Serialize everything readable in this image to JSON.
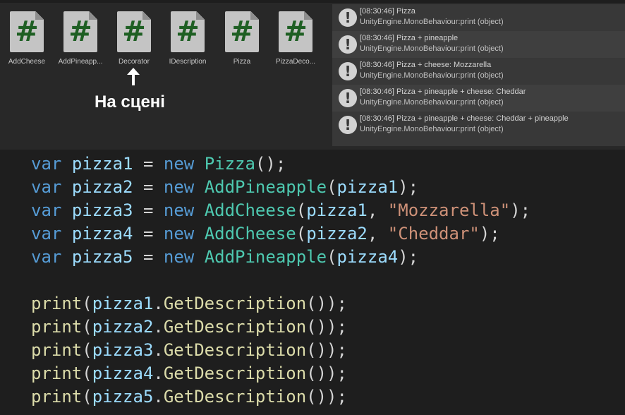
{
  "project": {
    "assets": [
      {
        "name": "AddCheese",
        "icon": "csharp-script-icon"
      },
      {
        "name": "AddPineapp...",
        "icon": "csharp-script-icon"
      },
      {
        "name": "Decorator",
        "icon": "csharp-script-icon"
      },
      {
        "name": "IDescription",
        "icon": "csharp-script-icon"
      },
      {
        "name": "Pizza",
        "icon": "csharp-script-icon"
      },
      {
        "name": "PizzaDeco...",
        "icon": "csharp-script-icon"
      }
    ],
    "icon_glyph": "#",
    "annotation": "На сцені"
  },
  "console": {
    "entries": [
      {
        "line1": "[08:30:46] Pizza",
        "line2": "UnityEngine.MonoBehaviour:print (object)"
      },
      {
        "line1": "[08:30:46] Pizza + pineapple",
        "line2": "UnityEngine.MonoBehaviour:print (object)"
      },
      {
        "line1": "[08:30:46] Pizza + cheese: Mozzarella",
        "line2": "UnityEngine.MonoBehaviour:print (object)"
      },
      {
        "line1": "[08:30:46] Pizza + pineapple + cheese: Cheddar",
        "line2": "UnityEngine.MonoBehaviour:print (object)"
      },
      {
        "line1": "[08:30:46] Pizza + pineapple + cheese: Cheddar + pineapple",
        "line2": "UnityEngine.MonoBehaviour:print (object)"
      }
    ],
    "icon": "!"
  },
  "code": {
    "lines": [
      [
        {
          "t": "var",
          "c": "kw"
        },
        {
          "t": " ",
          "c": "pn"
        },
        {
          "t": "pizza1",
          "c": "var"
        },
        {
          "t": " = ",
          "c": "pn"
        },
        {
          "t": "new",
          "c": "kw"
        },
        {
          "t": " ",
          "c": "pn"
        },
        {
          "t": "Pizza",
          "c": "type"
        },
        {
          "t": "();",
          "c": "pn"
        }
      ],
      [
        {
          "t": "var",
          "c": "kw"
        },
        {
          "t": " ",
          "c": "pn"
        },
        {
          "t": "pizza2",
          "c": "var"
        },
        {
          "t": " = ",
          "c": "pn"
        },
        {
          "t": "new",
          "c": "kw"
        },
        {
          "t": " ",
          "c": "pn"
        },
        {
          "t": "AddPineapple",
          "c": "type"
        },
        {
          "t": "(",
          "c": "pn"
        },
        {
          "t": "pizza1",
          "c": "var"
        },
        {
          "t": ");",
          "c": "pn"
        }
      ],
      [
        {
          "t": "var",
          "c": "kw"
        },
        {
          "t": " ",
          "c": "pn"
        },
        {
          "t": "pizza3",
          "c": "var"
        },
        {
          "t": " = ",
          "c": "pn"
        },
        {
          "t": "new",
          "c": "kw"
        },
        {
          "t": " ",
          "c": "pn"
        },
        {
          "t": "AddCheese",
          "c": "type"
        },
        {
          "t": "(",
          "c": "pn"
        },
        {
          "t": "pizza1",
          "c": "var"
        },
        {
          "t": ", ",
          "c": "pn"
        },
        {
          "t": "\"Mozzarella\"",
          "c": "str"
        },
        {
          "t": ");",
          "c": "pn"
        }
      ],
      [
        {
          "t": "var",
          "c": "kw"
        },
        {
          "t": " ",
          "c": "pn"
        },
        {
          "t": "pizza4",
          "c": "var"
        },
        {
          "t": " = ",
          "c": "pn"
        },
        {
          "t": "new",
          "c": "kw"
        },
        {
          "t": " ",
          "c": "pn"
        },
        {
          "t": "AddCheese",
          "c": "type"
        },
        {
          "t": "(",
          "c": "pn"
        },
        {
          "t": "pizza2",
          "c": "var"
        },
        {
          "t": ", ",
          "c": "pn"
        },
        {
          "t": "\"Cheddar\"",
          "c": "str"
        },
        {
          "t": ");",
          "c": "pn"
        }
      ],
      [
        {
          "t": "var",
          "c": "kw"
        },
        {
          "t": " ",
          "c": "pn"
        },
        {
          "t": "pizza5",
          "c": "var"
        },
        {
          "t": " = ",
          "c": "pn"
        },
        {
          "t": "new",
          "c": "kw"
        },
        {
          "t": " ",
          "c": "pn"
        },
        {
          "t": "AddPineapple",
          "c": "type"
        },
        {
          "t": "(",
          "c": "pn"
        },
        {
          "t": "pizza4",
          "c": "var"
        },
        {
          "t": ");",
          "c": "pn"
        }
      ],
      [],
      [
        {
          "t": "print",
          "c": "fn"
        },
        {
          "t": "(",
          "c": "pn"
        },
        {
          "t": "pizza1",
          "c": "var"
        },
        {
          "t": ".",
          "c": "pn"
        },
        {
          "t": "GetDescription",
          "c": "fn"
        },
        {
          "t": "());",
          "c": "pn"
        }
      ],
      [
        {
          "t": "print",
          "c": "fn"
        },
        {
          "t": "(",
          "c": "pn"
        },
        {
          "t": "pizza2",
          "c": "var"
        },
        {
          "t": ".",
          "c": "pn"
        },
        {
          "t": "GetDescription",
          "c": "fn"
        },
        {
          "t": "());",
          "c": "pn"
        }
      ],
      [
        {
          "t": "print",
          "c": "fn"
        },
        {
          "t": "(",
          "c": "pn"
        },
        {
          "t": "pizza3",
          "c": "var"
        },
        {
          "t": ".",
          "c": "pn"
        },
        {
          "t": "GetDescription",
          "c": "fn"
        },
        {
          "t": "());",
          "c": "pn"
        }
      ],
      [
        {
          "t": "print",
          "c": "fn"
        },
        {
          "t": "(",
          "c": "pn"
        },
        {
          "t": "pizza4",
          "c": "var"
        },
        {
          "t": ".",
          "c": "pn"
        },
        {
          "t": "GetDescription",
          "c": "fn"
        },
        {
          "t": "());",
          "c": "pn"
        }
      ],
      [
        {
          "t": "print",
          "c": "fn"
        },
        {
          "t": "(",
          "c": "pn"
        },
        {
          "t": "pizza5",
          "c": "var"
        },
        {
          "t": ".",
          "c": "pn"
        },
        {
          "t": "GetDescription",
          "c": "fn"
        },
        {
          "t": "());",
          "c": "pn"
        }
      ]
    ]
  },
  "colors": {
    "keyword": "#569cd6",
    "variable": "#9cdcfe",
    "type": "#4ec9b0",
    "string": "#ce9178",
    "method": "#dcdcaa",
    "csharp_icon_hash": "#1e5f23"
  }
}
